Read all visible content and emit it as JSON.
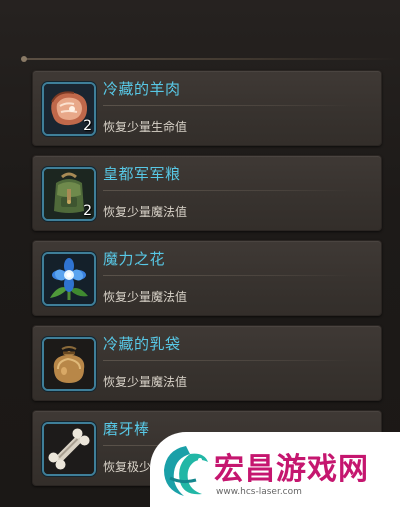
{
  "inventory": {
    "items": [
      {
        "name": "冷藏的羊肉",
        "description": "恢复少量生命值",
        "quantity": "2",
        "icon": "raw-meat-icon"
      },
      {
        "name": "皇都军军粮",
        "description": "恢复少量魔法值",
        "quantity": "2",
        "icon": "backpack-ration-icon"
      },
      {
        "name": "魔力之花",
        "description": "恢复少量魔法值",
        "quantity": "",
        "icon": "blue-flower-icon"
      },
      {
        "name": "冷藏的乳袋",
        "description": "恢复少量魔法值",
        "quantity": "",
        "icon": "milk-pouch-icon"
      },
      {
        "name": "磨牙棒",
        "description": "恢复极少",
        "quantity": "",
        "icon": "bone-stick-icon"
      }
    ]
  },
  "watermark": {
    "title": "宏昌游戏网",
    "url": "www.hcs-laser.com"
  },
  "colors": {
    "item_name": "#58c8e6",
    "item_desc": "#d8d2c8",
    "icon_border": "#3f7f99",
    "watermark_title": "#c5166f"
  }
}
